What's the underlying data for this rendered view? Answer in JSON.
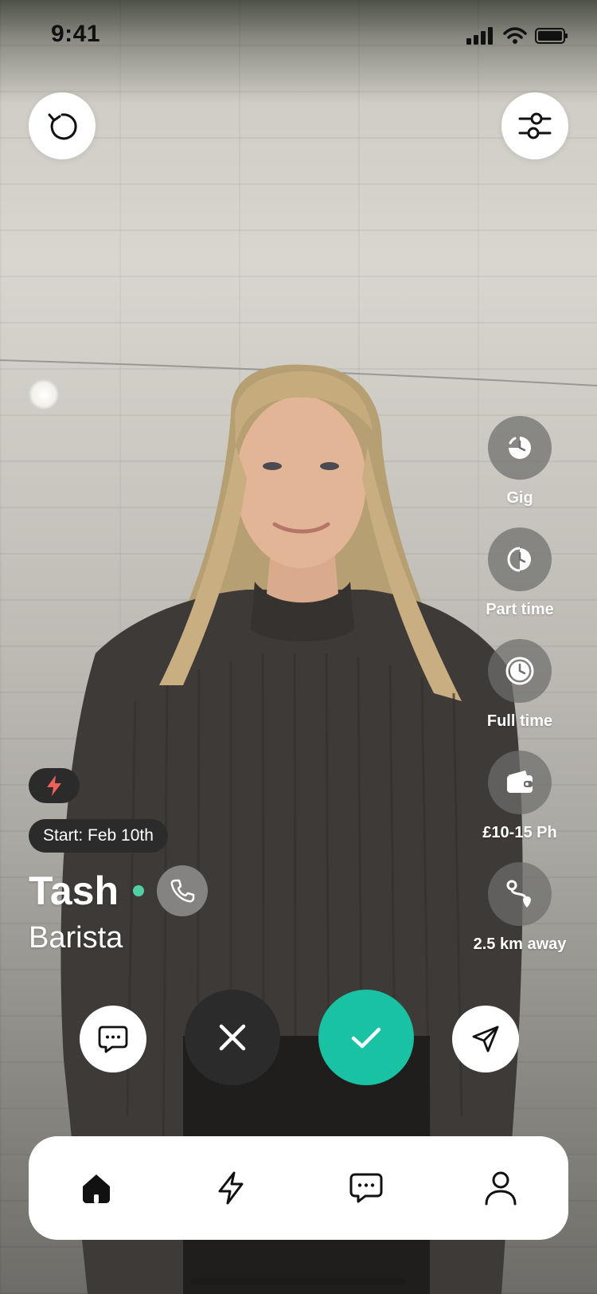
{
  "status_bar": {
    "time": "9:41"
  },
  "top_controls": {
    "undo_icon": "undo-icon",
    "filter_icon": "sliders-icon"
  },
  "job_types": [
    {
      "label": "Gig",
      "icon": "clock-quarter-icon"
    },
    {
      "label": "Part time",
      "icon": "clock-half-icon"
    },
    {
      "label": "Full time",
      "icon": "clock-full-icon"
    },
    {
      "label": "£10-15 Ph",
      "icon": "wallet-icon"
    },
    {
      "label": "2.5 km away",
      "icon": "route-icon"
    }
  ],
  "profile": {
    "start": "Start: Feb 10th",
    "name": "Tash",
    "role": "Barista",
    "online": true
  },
  "actions": [
    "chat-icon",
    "close-icon",
    "check-icon",
    "send-icon"
  ],
  "tabs": [
    "home-icon",
    "bolt-icon",
    "chat-icon",
    "user-icon"
  ],
  "colors": {
    "accent": "#19C2A2",
    "online": "#4FD1A5",
    "boost": "#F0605A",
    "dark": "#2B2B2B"
  }
}
